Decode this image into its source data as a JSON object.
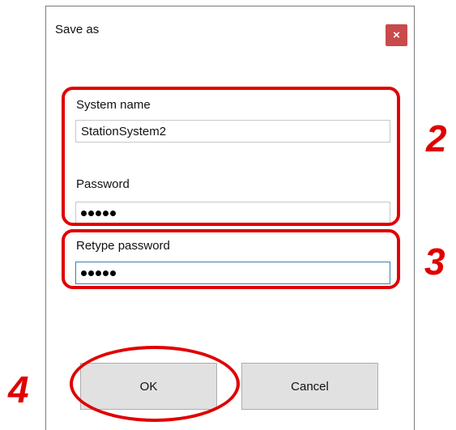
{
  "dialog": {
    "title": "Save as",
    "close_label": "×",
    "close_color": "#c94a4a"
  },
  "form": {
    "system_name_label": "System name",
    "system_name_value": "StationSystem2",
    "password_label": "Password",
    "password_length": 5,
    "retype_label": "Retype password",
    "retype_length": 5
  },
  "buttons": {
    "ok_label": "OK",
    "cancel_label": "Cancel"
  },
  "annotations": {
    "color": "#e00000",
    "group_credentials_number": "2",
    "group_retype_number": "3",
    "ok_button_number": "4"
  }
}
